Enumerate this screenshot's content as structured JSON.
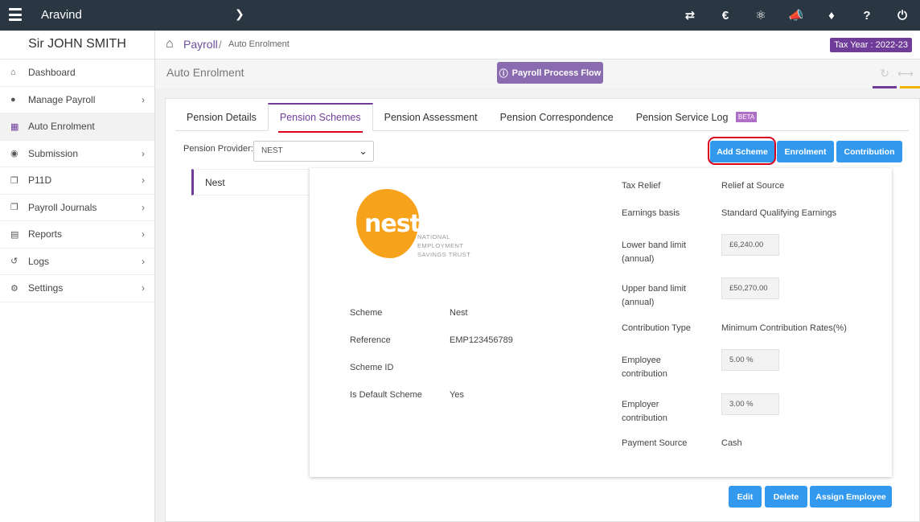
{
  "topbar": {
    "user": "Aravind",
    "icons": [
      "swap-icon",
      "currency-icon",
      "network-icon",
      "megaphone-icon",
      "ticket-icon",
      "help-icon",
      "power-icon"
    ]
  },
  "sidebar": {
    "company": "Sir JOHN SMITH",
    "items": [
      {
        "label": "Dashboard",
        "icon": "home-icon",
        "chevron": false
      },
      {
        "label": "Manage Payroll",
        "icon": "user-icon",
        "chevron": true
      },
      {
        "label": "Auto Enrolment",
        "icon": "grid-icon",
        "chevron": false,
        "active": true
      },
      {
        "label": "Submission",
        "icon": "users-icon",
        "chevron": true
      },
      {
        "label": "P11D",
        "icon": "copy-icon",
        "chevron": true
      },
      {
        "label": "Payroll Journals",
        "icon": "copy-icon",
        "chevron": true
      },
      {
        "label": "Reports",
        "icon": "report-icon",
        "chevron": true
      },
      {
        "label": "Logs",
        "icon": "history-icon",
        "chevron": true
      },
      {
        "label": "Settings",
        "icon": "gear-icon",
        "chevron": true
      }
    ]
  },
  "breadcrumb": {
    "root": "Payroll",
    "separator": "/",
    "current": "Auto Enrolment",
    "tax_year": "Tax Year : 2022-23"
  },
  "page": {
    "title": "Auto Enrolment",
    "flow_button": "Payroll Process Flow"
  },
  "tabs": [
    {
      "label": "Pension Details"
    },
    {
      "label": "Pension Schemes",
      "active": true
    },
    {
      "label": "Pension Assessment"
    },
    {
      "label": "Pension Correspondence"
    },
    {
      "label": "Pension Service Log",
      "badge": "BETA"
    }
  ],
  "provider": {
    "label": "Pension Provider:",
    "value": "NEST"
  },
  "actions": {
    "add_scheme": "Add Scheme",
    "enrolment": "Enrolment",
    "contribution": "Contribution"
  },
  "scheme_list": [
    "Nest"
  ],
  "logo": {
    "word": "nest",
    "line1": "NATIONAL",
    "line2": "EMPLOYMENT",
    "line3": "SAVINGS TRUST"
  },
  "details_left": [
    {
      "label": "Scheme",
      "value": "Nest"
    },
    {
      "label": "Reference",
      "value": "EMP123456789"
    },
    {
      "label": "Scheme ID",
      "value": ""
    },
    {
      "label": "Is Default Scheme",
      "value": "Yes"
    }
  ],
  "details_right": {
    "tax_relief": {
      "label": "Tax Relief",
      "value": "Relief at Source"
    },
    "earnings_basis": {
      "label": "Earnings basis",
      "value": "Standard Qualifying Earnings"
    },
    "lower_band": {
      "label1": "Lower band limit",
      "label2": "(annual)",
      "value": "£6,240.00"
    },
    "upper_band": {
      "label1": "Upper band limit",
      "label2": "(annual)",
      "value": "£50,270.00"
    },
    "contribution_type": {
      "label": "Contribution Type",
      "value": "Minimum Contribution Rates(%)"
    },
    "employee": {
      "label1": "Employee",
      "label2": "contribution",
      "value": "5.00 %"
    },
    "employer": {
      "label1": "Employer",
      "label2": "contribution",
      "value": "3.00 %"
    },
    "payment_source": {
      "label": "Payment Source",
      "value": "Cash"
    }
  },
  "footer_actions": {
    "edit": "Edit",
    "delete": "Delete",
    "assign": "Assign Employee"
  },
  "colors": {
    "topbar": "#2b3643",
    "purple": "#6f3d99",
    "button_blue": "#3399ee",
    "highlight_red": "#d8001b",
    "nest_orange": "#f7a21b"
  }
}
